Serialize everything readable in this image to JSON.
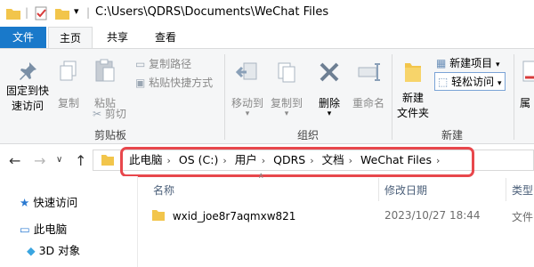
{
  "window": {
    "title": "C:\\Users\\QDRS\\Documents\\WeChat Files"
  },
  "tabs": {
    "file": "文件",
    "home": "主页",
    "share": "共享",
    "view": "查看"
  },
  "ribbon": {
    "pin_label_1": "固定到快",
    "pin_label_2": "速访问",
    "copy": "复制",
    "paste": "粘贴",
    "copy_path": "复制路径",
    "paste_shortcut": "粘贴快捷方式",
    "cut": "剪切",
    "clipboard_group": "剪贴板",
    "move_to": "移动到",
    "copy_to": "复制到",
    "delete": "删除",
    "rename": "重命名",
    "organize_group": "组织",
    "new_folder_1": "新建",
    "new_folder_2": "文件夹",
    "new_item": "新建项目",
    "easy_access": "轻松访问",
    "new_group": "新建",
    "properties_partial": "属"
  },
  "address": {
    "crumbs": [
      "此电脑",
      "OS (C:)",
      "用户",
      "QDRS",
      "文档",
      "WeChat Files"
    ]
  },
  "navpane": {
    "items": [
      "快速访问",
      "此电脑",
      "3D 对象"
    ]
  },
  "filelist": {
    "headers": {
      "name": "名称",
      "modified": "修改日期",
      "type": "类型"
    },
    "rows": [
      {
        "name": "wxid_joe8r7aqmxw821",
        "modified": "2023/10/27 18:44",
        "type": "文件"
      }
    ]
  },
  "colors": {
    "accent": "#1979ca",
    "highlight": "#e8474c",
    "folder": "#f2c54b"
  }
}
